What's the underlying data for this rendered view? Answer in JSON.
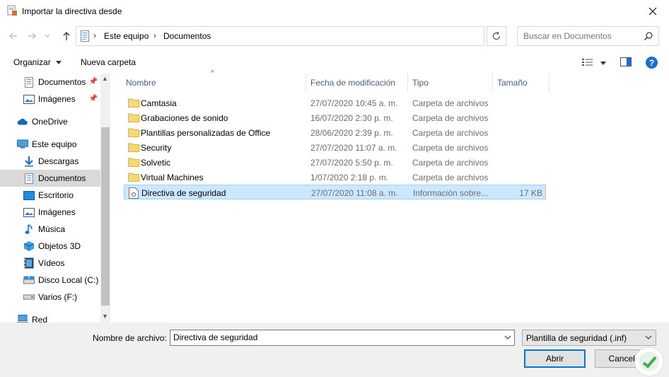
{
  "window": {
    "title": "Importar la directiva desde"
  },
  "address": {
    "crumbs": [
      "Este equipo",
      "Documentos"
    ],
    "search_placeholder": "Buscar en Documentos"
  },
  "toolbar": {
    "organize_label": "Organizar",
    "new_folder_label": "Nueva carpeta"
  },
  "nav": {
    "items": [
      {
        "label": "Documentos",
        "icon": "document-icon",
        "pinned": true
      },
      {
        "label": "Imágenes",
        "icon": "pictures-icon",
        "pinned": true
      },
      {
        "label": "OneDrive",
        "icon": "cloud-icon"
      },
      {
        "label": "Este equipo",
        "icon": "computer-icon"
      },
      {
        "label": "Descargas",
        "icon": "download-icon"
      },
      {
        "label": "Documentos",
        "icon": "document-icon"
      },
      {
        "label": "Escritorio",
        "icon": "desktop-icon"
      },
      {
        "label": "Imágenes",
        "icon": "pictures-icon"
      },
      {
        "label": "Música",
        "icon": "music-icon"
      },
      {
        "label": "Objetos 3D",
        "icon": "3d-objects-icon"
      },
      {
        "label": "Vídeos",
        "icon": "video-icon"
      },
      {
        "label": "Disco Local (C:)",
        "icon": "drive-icon"
      },
      {
        "label": "Varios (F:)",
        "icon": "drive-icon"
      },
      {
        "label": "Red",
        "icon": "network-icon"
      }
    ]
  },
  "columns": {
    "name": "Nombre",
    "date": "Fecha de modificación",
    "type": "Tipo",
    "size": "Tamaño"
  },
  "files": [
    {
      "name": "Camtasia",
      "date": "27/07/2020 10:45 a. m.",
      "type": "Carpeta de archivos",
      "size": ""
    },
    {
      "name": "Grabaciones de sonido",
      "date": "16/07/2020 2:30 p. m.",
      "type": "Carpeta de archivos",
      "size": ""
    },
    {
      "name": "Plantillas personalizadas de Office",
      "date": "28/06/2020 2:39 p. m.",
      "type": "Carpeta de archivos",
      "size": ""
    },
    {
      "name": "Security",
      "date": "27/07/2020 11:07 a. m.",
      "type": "Carpeta de archivos",
      "size": ""
    },
    {
      "name": "Solvetic",
      "date": "27/07/2020 5:50 p. m.",
      "type": "Carpeta de archivos",
      "size": ""
    },
    {
      "name": "Virtual Machines",
      "date": "1/07/2020 2:18 p. m.",
      "type": "Carpeta de archivos",
      "size": ""
    },
    {
      "name": "Directiva de seguridad",
      "date": "27/07/2020 11:08 a. m.",
      "type": "Información sobre...",
      "size": "17 KB"
    }
  ],
  "footer": {
    "filename_label": "Nombre de archivo:",
    "filename_value": "Directiva de seguridad",
    "filetype_value": "Plantilla de seguridad (.inf)",
    "open_label": "Abrir",
    "cancel_label": "Cancelar"
  },
  "colors": {
    "selection": "#cce8ff",
    "accent": "#0078d7",
    "folder": "#f8d775"
  }
}
